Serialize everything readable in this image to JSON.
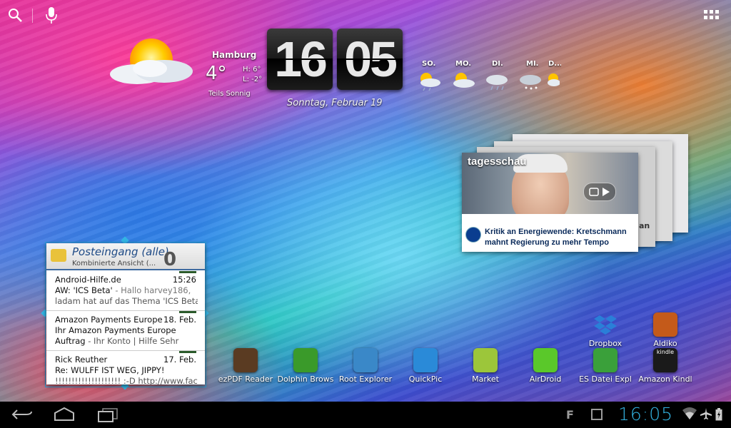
{
  "top_bar": {
    "search_icon": "search-icon",
    "mic_icon": "microphone-icon",
    "apps_icon": "all-apps-grid-icon"
  },
  "weather": {
    "city": "Hamburg",
    "temp": "4°",
    "high": "H: 6°",
    "low": "L: -2°",
    "condition": "Teils Sonnig",
    "forecast": [
      {
        "day": "SO."
      },
      {
        "day": "MO."
      },
      {
        "day": "DI."
      },
      {
        "day": "MI."
      },
      {
        "day": "D..."
      }
    ]
  },
  "clock": {
    "hour": "16",
    "minute": "05",
    "date": "Sonntag, Februar 19"
  },
  "news": {
    "source": "tagesschau",
    "headline": "Kritik an Energiewende: Kretschmann mahnt Regierung zu mehr Tempo",
    "side_fragment": "an"
  },
  "email": {
    "title": "Posteingang (alle)",
    "subtitle": "Kombinierte Ansicht (...",
    "count": "0",
    "items": [
      {
        "from": "Android-Hilfe.de",
        "date": "15:26",
        "subject": "AW: 'ICS Beta'",
        "preview": " - Hallo harvey186,",
        "preview2": "ladam hat auf das Thema 'ICS Beta'"
      },
      {
        "from": "Amazon Payments Europe",
        "date": "18. Feb.",
        "subject": "Ihr Amazon Payments Europe",
        "preview": "Auftrag",
        "preview2": " - Ihr Konto | Hilfe Sehr"
      },
      {
        "from": "Rick Reuther",
        "date": "17. Feb.",
        "subject": "Re: WULFF IST WEG, JIPPY!",
        "preview": "!!!!!!!!!!!!!!!!!!!! :-D http://www.facebook"
      }
    ]
  },
  "apps": [
    {
      "label": "ezPDF Reader",
      "icon": "ezpdf-icon",
      "color": "#5a3b22"
    },
    {
      "label": "Dolphin Brows",
      "icon": "dolphin-icon",
      "color": "#3a9a2a"
    },
    {
      "label": "Root Explorer",
      "icon": "root-explorer-icon",
      "color": "#3a88c8"
    },
    {
      "label": "QuickPic",
      "icon": "quickpic-icon",
      "color": "#2a8ad8"
    },
    {
      "label": "Market",
      "icon": "market-icon",
      "color": "#9cc63a"
    },
    {
      "label": "AirDroid",
      "icon": "airdroid-icon",
      "color": "#5ac82a"
    },
    {
      "label": "ES Datei Expl",
      "icon": "es-file-explorer-icon",
      "color": "#3aa03a"
    },
    {
      "label": "Amazon Kindl",
      "icon": "kindle-icon",
      "color": "#1a1a1a"
    },
    {
      "label": "Dropbox",
      "icon": "dropbox-icon",
      "color": "#2a7fd8"
    },
    {
      "label": "Aldiko",
      "icon": "aldiko-icon",
      "color": "#c45a1a"
    }
  ],
  "kindle_badge": "kindle",
  "system_bar": {
    "back_icon": "back-icon",
    "home_icon": "home-icon",
    "recents_icon": "recent-apps-icon",
    "notif_letter": "F",
    "time": "16:05",
    "accent": "#33b5e5"
  }
}
